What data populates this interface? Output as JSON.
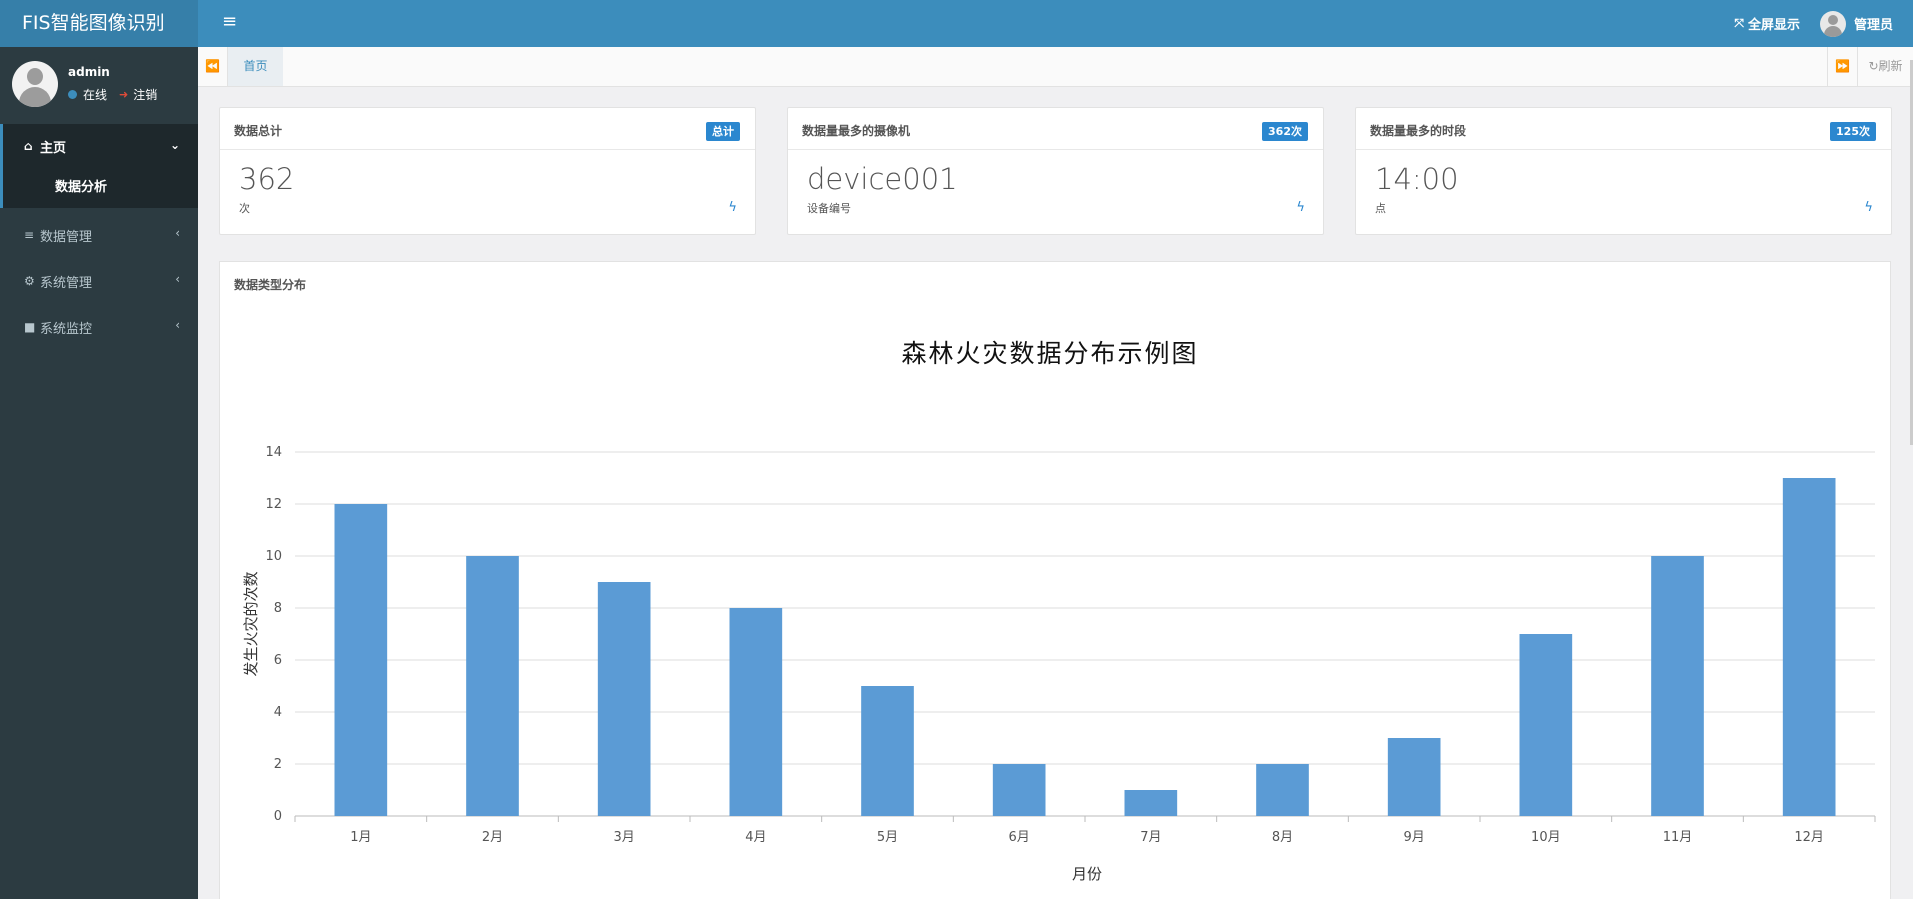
{
  "app": {
    "title": "FIS智能图像识别"
  },
  "header": {
    "fullscreen_label": "全屏显示",
    "admin_label": "管理员"
  },
  "user": {
    "name": "admin",
    "status": "在线",
    "logout": "注销"
  },
  "sidebar": {
    "items": [
      {
        "label": "主页",
        "icon": "home-icon",
        "children": [
          {
            "label": "数据分析"
          }
        ]
      },
      {
        "label": "数据管理",
        "icon": "list-icon"
      },
      {
        "label": "系统管理",
        "icon": "gear-icon"
      },
      {
        "label": "系统监控",
        "icon": "video-camera-icon"
      }
    ]
  },
  "tabs": {
    "home": "首页",
    "refresh": "刷新"
  },
  "cards": [
    {
      "title": "数据总计",
      "badge": "总计",
      "value": "362",
      "sub": "次"
    },
    {
      "title": "数据量最多的摄像机",
      "badge": "362次",
      "value": "device001",
      "sub": "设备编号"
    },
    {
      "title": "数据量最多的时段",
      "badge": "125次",
      "value": "14:00",
      "sub": "点"
    }
  ],
  "panel": {
    "title": "数据类型分布"
  },
  "chart_data": {
    "type": "bar",
    "title": "森林火灾数据分布示例图",
    "xlabel": "月份",
    "ylabel": "发生火灾的次数",
    "categories": [
      "1月",
      "2月",
      "3月",
      "4月",
      "5月",
      "6月",
      "7月",
      "8月",
      "9月",
      "10月",
      "11月",
      "12月"
    ],
    "values": [
      12,
      10,
      9,
      8,
      5,
      2,
      1,
      2,
      3,
      7,
      10,
      13
    ],
    "ylim": [
      0,
      14
    ],
    "yticks": [
      0,
      2,
      4,
      6,
      8,
      10,
      12,
      14
    ],
    "bar_color": "#5b9bd5",
    "grid": true
  }
}
